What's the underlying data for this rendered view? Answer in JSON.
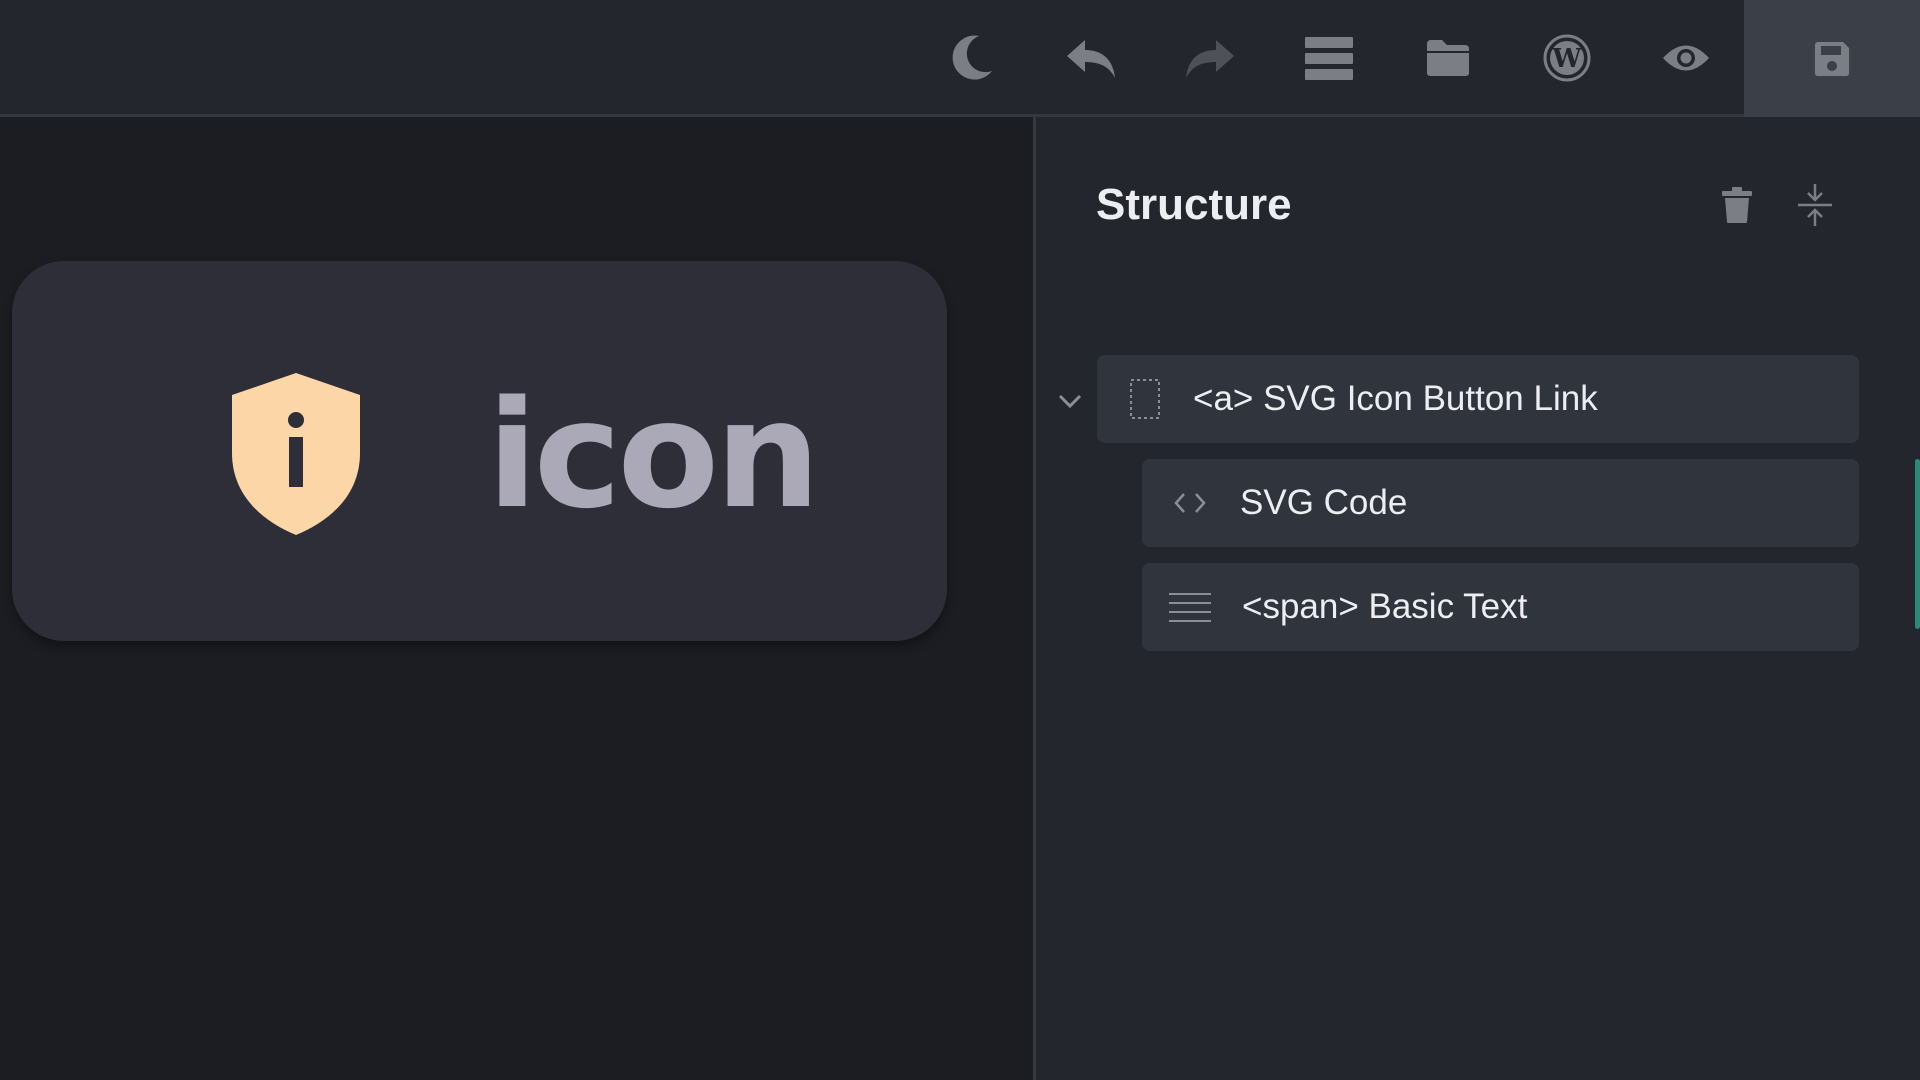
{
  "toolbar": {
    "icons": [
      "moon-icon",
      "undo-icon",
      "redo-icon",
      "menu-icon",
      "folder-icon",
      "wordpress-icon",
      "eye-icon",
      "save-icon"
    ]
  },
  "preview": {
    "text": "icon",
    "shield_color": "#fdd6a7"
  },
  "structure": {
    "title": "Structure",
    "items": [
      {
        "label": "<a> SVG Icon Button Link",
        "icon": "link-box-icon",
        "depth": 0
      },
      {
        "label": "SVG Code",
        "icon": "code-icon",
        "depth": 1
      },
      {
        "label": "<span> Basic Text",
        "icon": "text-lines-icon",
        "depth": 1
      }
    ]
  },
  "colors": {
    "topbar": "#23262d",
    "canvas": "#1c1d22",
    "panel": "#23262d",
    "accent": "#2a8a78"
  }
}
